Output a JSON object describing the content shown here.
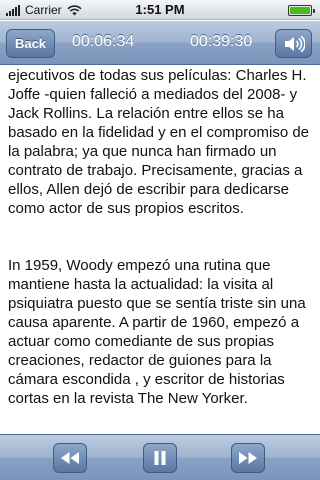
{
  "status_bar": {
    "carrier": "Carrier",
    "time": "1:51 PM",
    "battery_level": 1.0
  },
  "player": {
    "back_label": "Back",
    "elapsed": "00:06:34",
    "total": "00:39:30",
    "volume_icon": "speaker-icon"
  },
  "content": {
    "paragraphs": [
      "ejecutivos de todas sus películas: Charles H. Joffe -quien falleció a mediados del 2008- y Jack Rollins. La relación entre ellos se ha basado en la fidelidad y en el compromiso de la palabra; ya que nunca han firmado un contrato de trabajo. Precisamente, gracias a ellos, Allen dejó de escribir para dedicarse como actor de sus propios escritos.",
      "In 1959, Woody empezó una rutina que mantiene hasta la actualidad: la visita al psiquiatra puesto que se sentía triste sin una causa aparente. A partir de 1960, empezó a actuar como comediante de sus propias creaciones, redactor de guiones para  la cámara escondida , y escritor de historias cortas en la revista The New Yorker."
    ]
  },
  "toolbar": {
    "rewind_icon": "rewind-icon",
    "pause_icon": "pause-icon",
    "forward_icon": "fast-forward-icon"
  }
}
